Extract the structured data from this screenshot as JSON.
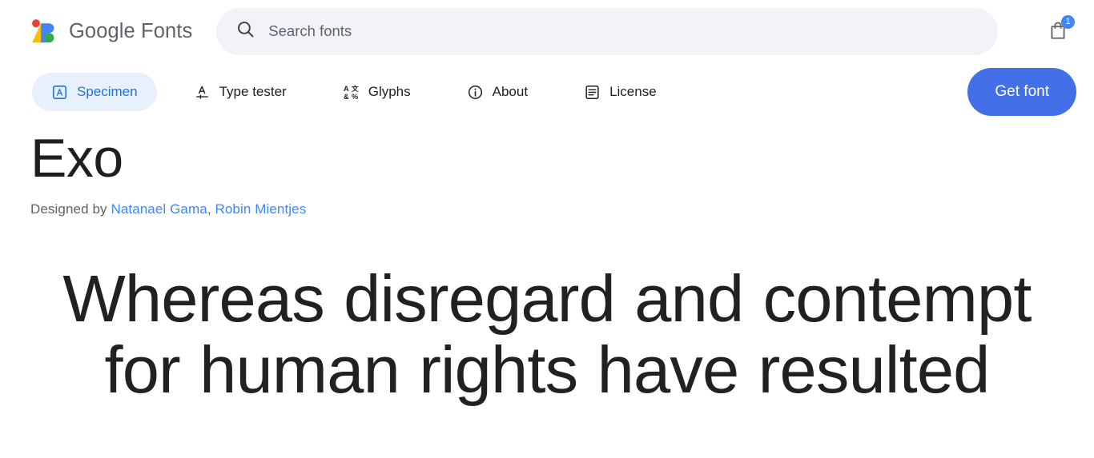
{
  "header": {
    "brand": {
      "logo_icon": "google-fonts-logo",
      "word_google": "Google",
      "word_fonts": "Fonts"
    },
    "search": {
      "icon": "search-icon",
      "placeholder": "Search fonts",
      "value": ""
    },
    "cart": {
      "icon": "shopping-bag-icon",
      "badge_count": "1"
    }
  },
  "tabs": [
    {
      "label": "Specimen",
      "icon": "specimen-icon",
      "active": true
    },
    {
      "label": "Type tester",
      "icon": "type-tester-icon",
      "active": false
    },
    {
      "label": "Glyphs",
      "icon": "glyphs-icon",
      "active": false
    },
    {
      "label": "About",
      "icon": "info-icon",
      "active": false
    },
    {
      "label": "License",
      "icon": "license-icon",
      "active": false
    }
  ],
  "actions": {
    "get_font_label": "Get font"
  },
  "font": {
    "name": "Exo",
    "designed_by_prefix": "Designed by ",
    "designers": [
      {
        "name": "Natanael Gama"
      },
      {
        "name": "Robin Mientjes"
      }
    ],
    "designer_separator": ", "
  },
  "specimen": {
    "text": "Whereas disregard and contempt for human rights have resulted"
  },
  "colors": {
    "accent_blue": "#1a73e8",
    "button_blue": "#4370e7",
    "link_blue": "#4285f4",
    "active_tab_bg": "#e8f0fe",
    "search_bg": "#f1f3f9",
    "text_primary": "#1f1f1f",
    "text_secondary": "#5f6368",
    "logo_red": "#ea4335",
    "logo_yellow": "#fbbc04",
    "logo_blue": "#4285f4",
    "logo_green": "#34a853"
  }
}
